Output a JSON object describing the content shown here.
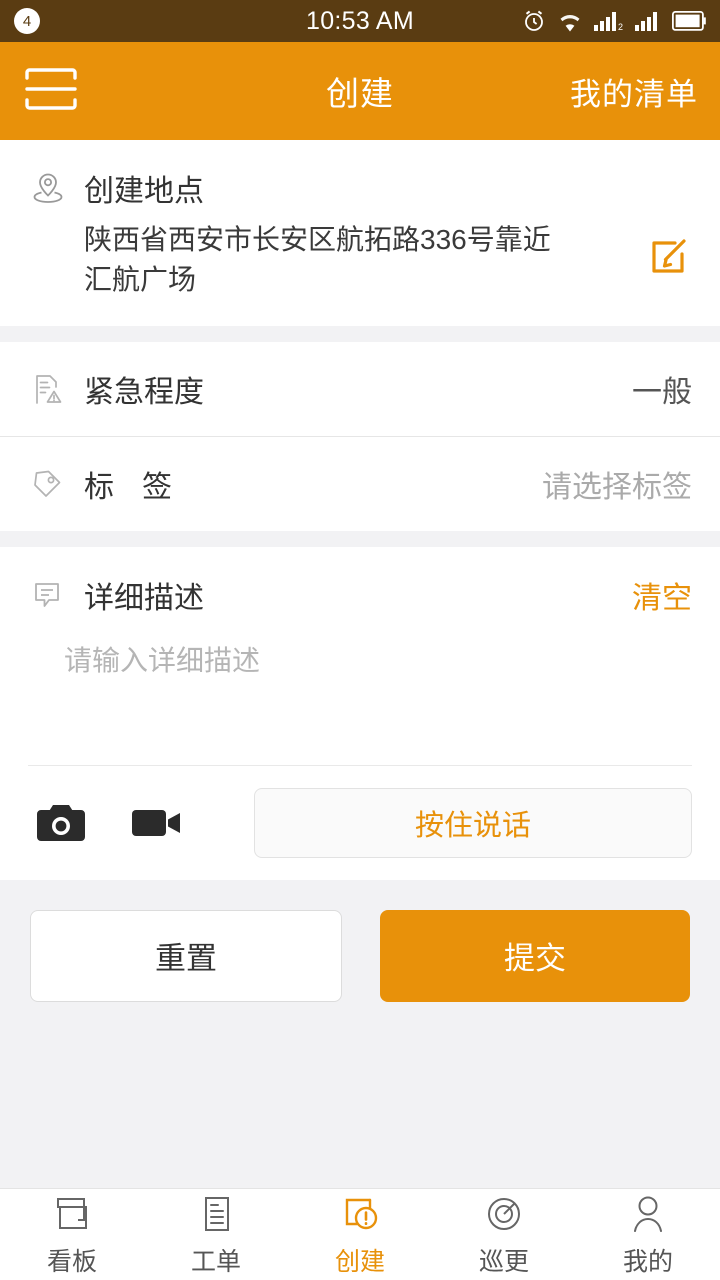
{
  "status_bar": {
    "notification_count": "4",
    "time": "10:53 AM",
    "icons": [
      "alarm-icon",
      "wifi-icon",
      "signal-sim2-icon",
      "signal-sim1-icon",
      "battery-icon"
    ]
  },
  "app_bar": {
    "menu_icon": "hamburger-menu-icon",
    "title": "创建",
    "action_label": "我的清单"
  },
  "colors": {
    "accent": "#e8910a",
    "status_bar_bg": "#5a3c12",
    "page_bg": "#f2f2f4",
    "card_bg": "#ffffff"
  },
  "location": {
    "icon": "map-pin-icon",
    "label": "创建地点",
    "address": "陕西省西安市长安区航拓路336号靠近汇航广场",
    "edit_icon": "edit-square-icon"
  },
  "urgency": {
    "icon": "document-warning-icon",
    "label": "紧急程度",
    "value": "一般"
  },
  "tag": {
    "icon": "tag-icon",
    "label": "标签",
    "placeholder": "请选择标签"
  },
  "description": {
    "icon": "comment-icon",
    "label": "详细描述",
    "clear_label": "清空",
    "placeholder": "请输入详细描述",
    "value": ""
  },
  "media": {
    "camera_icon": "camera-icon",
    "video_icon": "video-camera-icon",
    "voice_button_label": "按住说话"
  },
  "actions": {
    "reset_label": "重置",
    "submit_label": "提交"
  },
  "tabbar": {
    "items": [
      {
        "icon": "boards-icon",
        "label": "看板",
        "active": false
      },
      {
        "icon": "workorder-icon",
        "label": "工单",
        "active": false
      },
      {
        "icon": "create-icon",
        "label": "创建",
        "active": true
      },
      {
        "icon": "patrol-icon",
        "label": "巡更",
        "active": false
      },
      {
        "icon": "profile-icon",
        "label": "我的",
        "active": false
      }
    ]
  }
}
